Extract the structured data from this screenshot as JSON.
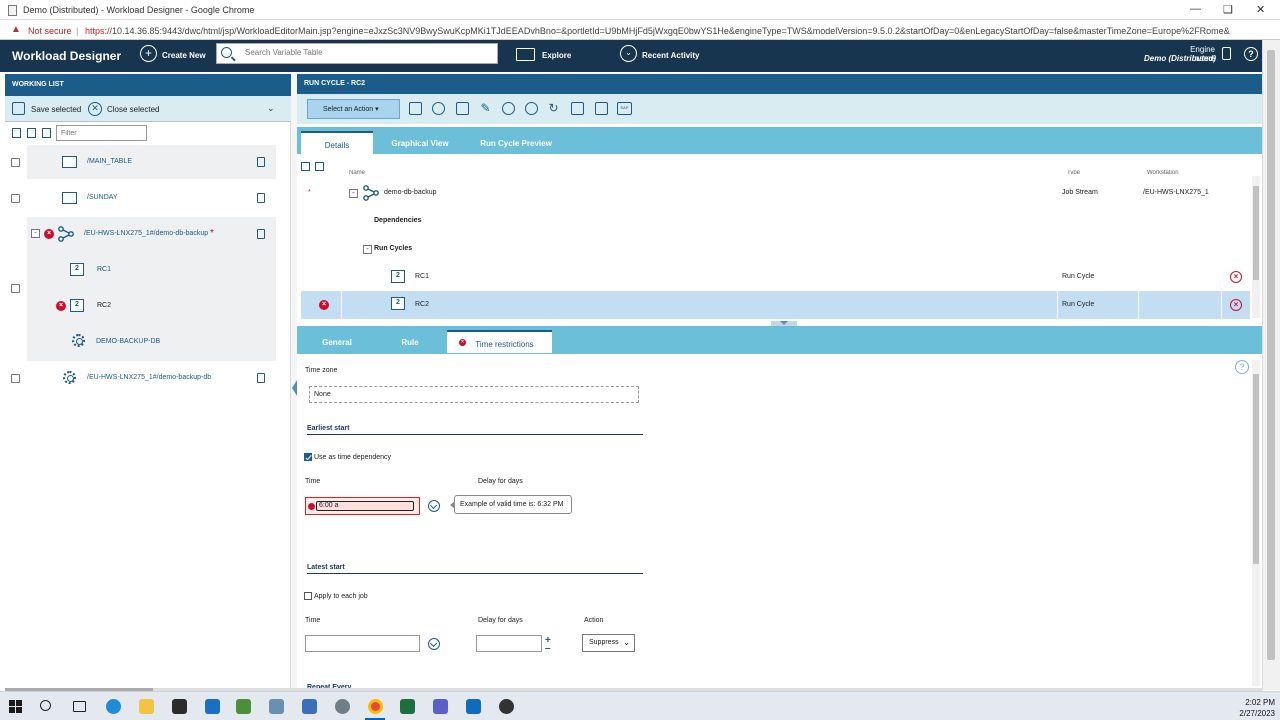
{
  "browser": {
    "window_title": "Demo (Distributed) - Workload Designer - Google Chrome",
    "security_label": "Not secure",
    "url_protocol": "https://",
    "url_rest": "10.14.36.85:9443/dwc/html/jsp/WorkloadEditorMain.jsp?engine=eJxzSc3NV9BwySwuKcpMKi1TJdEEADvhBno=&portletId=U9bMHjFd5jWxgqE0bwYS1He&engineType=TWS&modelVersion=9.5.0.2&startOfDay=0&enLegacyStartOfDay=false&masterTimeZone=Europe%2FRome&"
  },
  "header": {
    "app_title": "Workload Designer",
    "create_new": "Create New",
    "search_placeholder": "Search Variable Table",
    "explore": "Explore",
    "recent_activity": "Recent Activity",
    "engine_label": "Engine name",
    "engine_value": "Demo (Distributed)",
    "help": "?"
  },
  "working_list": {
    "title": "WORKING LIST",
    "save_selected": "Save selected",
    "close_selected": "Close selected",
    "filter_placeholder": "Filter",
    "items": [
      {
        "label": "/MAIN_TABLE"
      },
      {
        "label": "/SUNDAY"
      },
      {
        "label": "/EU-HWS-LNX275_1#/demo-db-backup",
        "modified": "*"
      },
      {
        "label": "RC1"
      },
      {
        "label": "RC2"
      },
      {
        "label": "DEMO-BACKUP-DB"
      },
      {
        "label": "/EU-HWS-LNX275_1#/demo-backup-db"
      }
    ]
  },
  "run_cycle": {
    "title": "RUN CYCLE - RC2",
    "select_action": "Select an Action",
    "toolbar_sap": "SAP",
    "tabs": [
      "Details",
      "Graphical View",
      "Run Cycle Preview"
    ],
    "columns": [
      "Name",
      "Type",
      "Workstation"
    ],
    "rows": [
      {
        "marker": "*",
        "name": "demo-db-backup",
        "type": "Job Stream",
        "workstation": "/EU-HWS-LNX275_1"
      },
      {
        "name": "Dependencies"
      },
      {
        "name": "Run Cycles"
      },
      {
        "name": "RC1",
        "type": "Run Cycle"
      },
      {
        "name": "RC2",
        "type": "Run Cycle"
      }
    ]
  },
  "detail_tabs": [
    "General",
    "Rule",
    "Time restrictions"
  ],
  "form": {
    "time_zone_label": "Time zone",
    "time_zone_value": "None",
    "earliest_start": "Earliest start",
    "use_as_dependency": "Use as time dependency",
    "time_label": "Time",
    "delay_label": "Delay for days",
    "time_value": "6:00 a",
    "tooltip": "Example of valid time is: 6:32 PM",
    "latest_start": "Latest start",
    "apply_each_job": "Apply to each job",
    "action_label": "Action",
    "action_value": "Suppress",
    "repeat_every": "Repeat Every"
  },
  "taskbar": {
    "time": "2:02 PM",
    "date": "2/27/2023"
  },
  "colors": {
    "header_bg": "#17354f",
    "panel_header": "#1b5c8a",
    "tab_bar": "#6cbfd8",
    "error_red": "#c8102e"
  }
}
